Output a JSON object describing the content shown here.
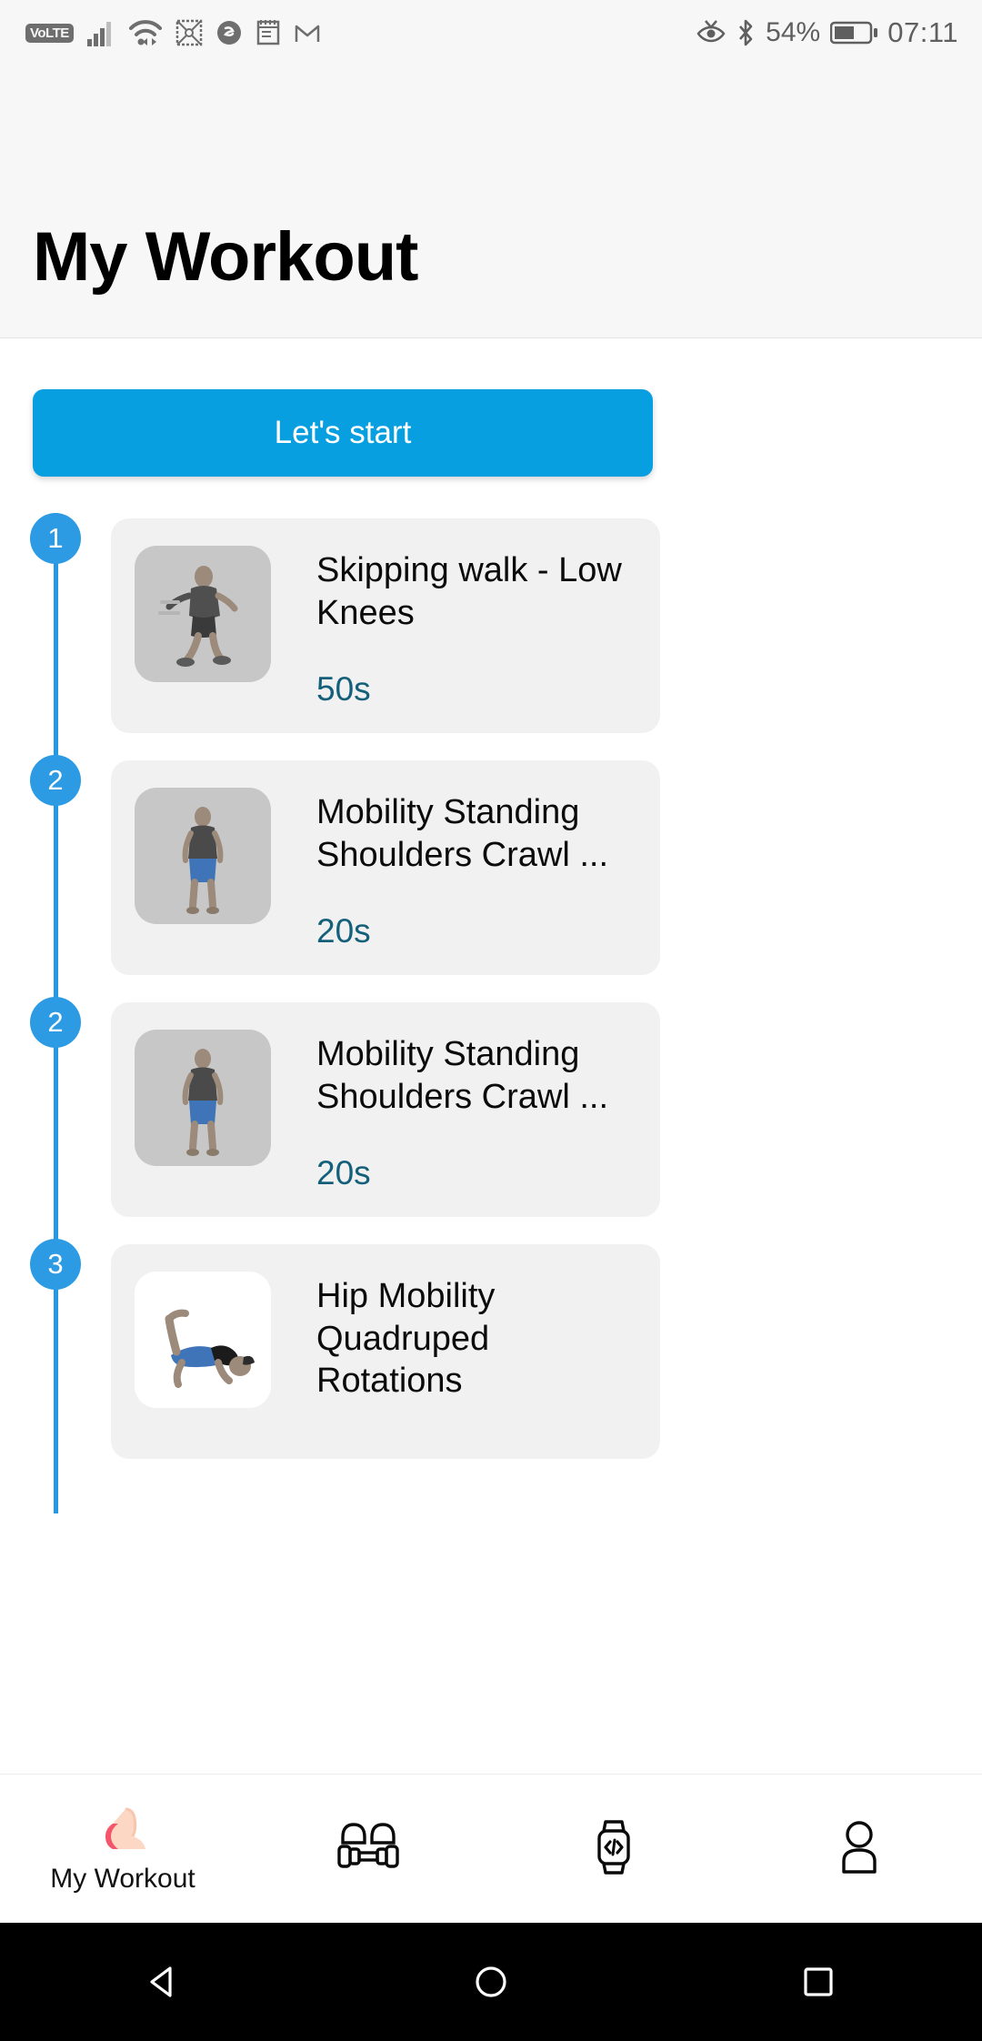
{
  "status_bar": {
    "left_icons": [
      "volte-icon",
      "signal-icon",
      "wifi-icon",
      "winrar-icon",
      "shazam-icon",
      "notes-icon",
      "gmail-icon"
    ],
    "volte_label": "VoLTE",
    "right_icons": [
      "eye-comfort-icon",
      "bluetooth-icon"
    ],
    "battery_percent": "54%",
    "time": "07:11"
  },
  "header": {
    "title": "My Workout"
  },
  "start_button": {
    "label": "Let's start"
  },
  "exercises": [
    {
      "step": "1",
      "title": "Skipping walk - Low Knees",
      "duration": "50s",
      "thumb_style": "gray"
    },
    {
      "step": "2",
      "title": "Mobility Standing Shoulders Crawl ...",
      "duration": "20s",
      "thumb_style": "gray"
    },
    {
      "step": "2",
      "title": "Mobility Standing Shoulders Crawl ...",
      "duration": "20s",
      "thumb_style": "gray"
    },
    {
      "step": "3",
      "title": "Hip Mobility Quadruped Rotations",
      "duration": "",
      "thumb_style": "white"
    }
  ],
  "bottom_nav": [
    {
      "icon": "flexed-biceps-icon",
      "label": "My Workout",
      "active": true
    },
    {
      "icon": "dumbbell-icon",
      "label": "",
      "active": false
    },
    {
      "icon": "smartwatch-code-icon",
      "label": "",
      "active": false
    },
    {
      "icon": "person-icon",
      "label": "",
      "active": false
    }
  ],
  "android_nav": [
    "back-icon",
    "home-icon",
    "recents-icon"
  ],
  "colors": {
    "accent_blue": "#089fe0",
    "step_blue": "#2d9ae4",
    "duration_teal": "#14607a",
    "card_bg": "#f1f1f1",
    "header_bg": "#f7f7f7"
  }
}
